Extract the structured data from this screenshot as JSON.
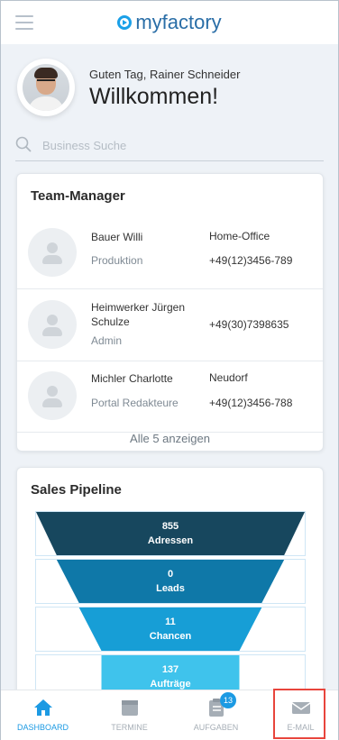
{
  "header": {
    "logo_text": "myfactory",
    "brand_color": "#1aa0e8"
  },
  "welcome": {
    "greeting": "Guten Tag, Rainer Schneider",
    "title": "Willkommen!"
  },
  "search": {
    "placeholder": "Business Suche"
  },
  "team_manager": {
    "title": "Team-Manager",
    "members": [
      {
        "name": "Bauer Willi",
        "role": "Produktion",
        "location": "Home-Office",
        "phone": "+49(12)3456-789"
      },
      {
        "name": "Heimwerker Jürgen Schulze",
        "role": "Admin",
        "location": "",
        "phone": "+49(30)7398635"
      },
      {
        "name": "Michler Charlotte",
        "role": "Portal Redakteure",
        "location": "Neudorf",
        "phone": "+49(12)3456-788"
      }
    ],
    "show_all": "Alle 5 anzeigen"
  },
  "sales_pipeline": {
    "title": "Sales Pipeline",
    "stages": [
      {
        "value": "855",
        "label": "Adressen",
        "color": "#17475e"
      },
      {
        "value": "0",
        "label": "Leads",
        "color": "#0f78a8"
      },
      {
        "value": "11",
        "label": "Chancen",
        "color": "#179ed6"
      },
      {
        "value": "137",
        "label": "Aufträge",
        "color": "#3fc3ec"
      }
    ]
  },
  "nav": {
    "dashboard": "DASHBOARD",
    "termine": "TERMINE",
    "aufgaben": "AUFGABEN",
    "aufgaben_badge": "13",
    "email": "E-MAIL",
    "active_color": "#1c9ae3",
    "highlight_color": "#e8453c"
  }
}
